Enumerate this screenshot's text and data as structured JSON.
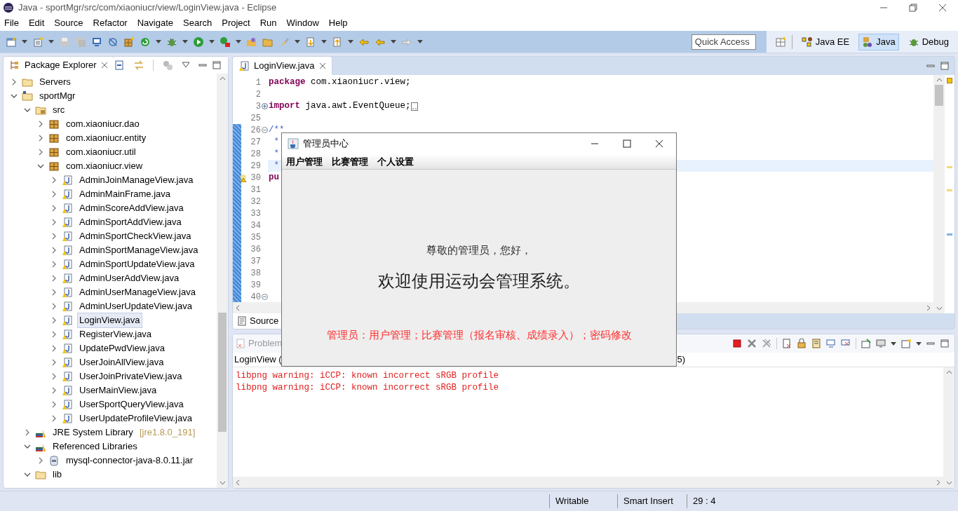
{
  "window": {
    "title": "Java - sportMgr/src/com/xiaoniucr/view/LoginView.java - Eclipse"
  },
  "menu": [
    "File",
    "Edit",
    "Source",
    "Refactor",
    "Navigate",
    "Search",
    "Project",
    "Run",
    "Window",
    "Help"
  ],
  "quick_access": {
    "placeholder": "Quick Access"
  },
  "perspectives": [
    {
      "label": "Java EE",
      "selected": false
    },
    {
      "label": "Java",
      "selected": true
    },
    {
      "label": "Debug",
      "selected": false
    }
  ],
  "package_explorer": {
    "tab": "Package Explorer",
    "tree": [
      {
        "label": "Servers",
        "kind": "folder",
        "expanded": false,
        "selected": false
      },
      {
        "label": "sportMgr",
        "kind": "project",
        "expanded": true,
        "selected": false,
        "children": [
          {
            "label": "src",
            "kind": "source",
            "expanded": true,
            "selected": false,
            "children": [
              {
                "label": "com.xiaoniucr.dao",
                "kind": "package",
                "expanded": false,
                "selected": false
              },
              {
                "label": "com.xiaoniucr.entity",
                "kind": "package",
                "expanded": false,
                "selected": false
              },
              {
                "label": "com.xiaoniucr.util",
                "kind": "package",
                "expanded": false,
                "selected": false
              },
              {
                "label": "com.xiaoniucr.view",
                "kind": "package",
                "expanded": true,
                "selected": false,
                "children": [
                  {
                    "label": "AdminJoinManageView.java",
                    "kind": "java",
                    "expanded": false,
                    "selected": false
                  },
                  {
                    "label": "AdminMainFrame.java",
                    "kind": "java",
                    "expanded": false,
                    "selected": false
                  },
                  {
                    "label": "AdminScoreAddView.java",
                    "kind": "java",
                    "expanded": false,
                    "selected": false
                  },
                  {
                    "label": "AdminSportAddView.java",
                    "kind": "java",
                    "expanded": false,
                    "selected": false
                  },
                  {
                    "label": "AdminSportCheckView.java",
                    "kind": "java",
                    "expanded": false,
                    "selected": false
                  },
                  {
                    "label": "AdminSportManageView.java",
                    "kind": "java",
                    "expanded": false,
                    "selected": false
                  },
                  {
                    "label": "AdminSportUpdateView.java",
                    "kind": "java",
                    "expanded": false,
                    "selected": false
                  },
                  {
                    "label": "AdminUserAddView.java",
                    "kind": "java",
                    "expanded": false,
                    "selected": false
                  },
                  {
                    "label": "AdminUserManageView.java",
                    "kind": "java",
                    "expanded": false,
                    "selected": false
                  },
                  {
                    "label": "AdminUserUpdateView.java",
                    "kind": "java",
                    "expanded": false,
                    "selected": false
                  },
                  {
                    "label": "LoginView.java",
                    "kind": "java",
                    "expanded": false,
                    "selected": true
                  },
                  {
                    "label": "RegisterView.java",
                    "kind": "java",
                    "expanded": false,
                    "selected": false
                  },
                  {
                    "label": "UpdatePwdView.java",
                    "kind": "java",
                    "expanded": false,
                    "selected": false
                  },
                  {
                    "label": "UserJoinAllView.java",
                    "kind": "java",
                    "expanded": false,
                    "selected": false
                  },
                  {
                    "label": "UserJoinPrivateView.java",
                    "kind": "java",
                    "expanded": false,
                    "selected": false
                  },
                  {
                    "label": "UserMainView.java",
                    "kind": "java",
                    "expanded": false,
                    "selected": false
                  },
                  {
                    "label": "UserSportQueryView.java",
                    "kind": "java",
                    "expanded": false,
                    "selected": false
                  },
                  {
                    "label": "UserUpdateProfileView.java",
                    "kind": "java",
                    "expanded": false,
                    "selected": false
                  }
                ]
              }
            ]
          },
          {
            "label": "JRE System Library",
            "detail": "[jre1.8.0_191]",
            "kind": "library",
            "expanded": false,
            "selected": false
          },
          {
            "label": "Referenced Libraries",
            "kind": "library",
            "expanded": true,
            "selected": false,
            "children": [
              {
                "label": "mysql-connector-java-8.0.11.jar",
                "kind": "jar",
                "expanded": false,
                "selected": false
              }
            ]
          },
          {
            "label": "lib",
            "kind": "folder",
            "expanded": true,
            "selected": false
          }
        ]
      }
    ]
  },
  "editor": {
    "tab": "LoginView.java",
    "bottom_tab": "Source",
    "lines": [
      {
        "number": "1",
        "changed": false,
        "current": false,
        "warning": false,
        "tokens": [
          {
            "text": "package",
            "kind": "keyword"
          },
          {
            "text": " com.xiaoniucr.view;",
            "kind": "plain"
          }
        ]
      },
      {
        "number": "2",
        "changed": false,
        "current": false,
        "warning": false
      },
      {
        "number": "3",
        "folded": true,
        "changed": false,
        "current": false,
        "warning": false,
        "tokens": [
          {
            "text": "import",
            "kind": "keyword"
          },
          {
            "text": " java.awt.EventQueue;",
            "kind": "plain"
          }
        ]
      },
      {
        "number": "25",
        "changed": false,
        "current": false,
        "warning": false
      },
      {
        "number": "26",
        "folded": false,
        "changed": true,
        "current": false,
        "warning": false,
        "tokens": [
          {
            "text": "/**",
            "kind": "doc"
          }
        ]
      },
      {
        "number": "27",
        "changed": true,
        "current": false,
        "warning": false,
        "tokens": [
          {
            "text": " *",
            "kind": "doc"
          }
        ]
      },
      {
        "number": "28",
        "changed": true,
        "current": false,
        "warning": false,
        "tokens": [
          {
            "text": " *",
            "kind": "doc"
          }
        ]
      },
      {
        "number": "29",
        "changed": true,
        "current": true,
        "warning": false,
        "tokens": [
          {
            "text": " *",
            "kind": "doc"
          }
        ]
      },
      {
        "number": "30",
        "changed": true,
        "current": false,
        "warning": true,
        "tokens": [
          {
            "text": "pu",
            "kind": "keyword"
          }
        ]
      },
      {
        "number": "31",
        "changed": true,
        "current": false,
        "warning": false
      },
      {
        "number": "32",
        "changed": true,
        "current": false,
        "warning": false
      },
      {
        "number": "33",
        "changed": true,
        "current": false,
        "warning": false
      },
      {
        "number": "34",
        "changed": true,
        "current": false,
        "warning": false
      },
      {
        "number": "35",
        "changed": true,
        "current": false,
        "warning": false
      },
      {
        "number": "36",
        "changed": true,
        "current": false,
        "warning": false
      },
      {
        "number": "37",
        "changed": true,
        "current": false,
        "warning": false
      },
      {
        "number": "38",
        "changed": true,
        "current": false,
        "warning": false
      },
      {
        "number": "39",
        "changed": true,
        "current": false,
        "warning": false
      },
      {
        "number": "40",
        "folded": false,
        "changed": true,
        "current": false,
        "warning": false
      }
    ]
  },
  "console": {
    "tab": "Problem",
    "title_start": "LoginView (",
    "title_end": "5)",
    "output": [
      "libpng warning: iCCP: known incorrect sRGB profile",
      "libpng warning: iCCP: known incorrect sRGB profile"
    ]
  },
  "status_bar": [
    "Writable",
    "Smart Insert",
    "29 : 4"
  ],
  "dialog": {
    "title": "管理员中心",
    "menu": [
      "用户管理",
      "比赛管理",
      "个人设置"
    ],
    "greeting": "尊敬的管理员，您好，",
    "headline": "欢迎使用运动会管理系统。",
    "note": "管理员：用户管理；比赛管理（报名审核、成绩录入）；密码修改"
  }
}
